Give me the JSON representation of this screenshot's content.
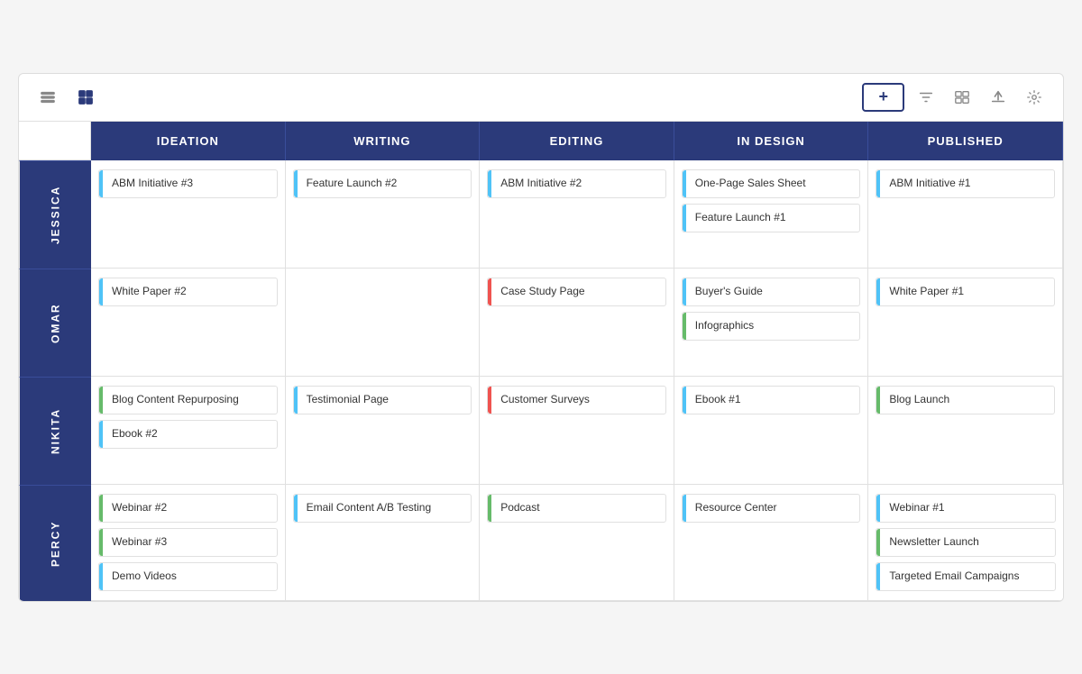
{
  "toolbar": {
    "add_label": "+",
    "views": [
      {
        "id": "list",
        "label": "List view"
      },
      {
        "id": "grid",
        "label": "Grid view"
      }
    ]
  },
  "columns": [
    {
      "id": "ideation",
      "label": "IDEATION"
    },
    {
      "id": "writing",
      "label": "WRITING"
    },
    {
      "id": "editing",
      "label": "EDITING"
    },
    {
      "id": "in_design",
      "label": "IN DESIGN"
    },
    {
      "id": "published",
      "label": "PUBLISHED"
    }
  ],
  "rows": [
    {
      "id": "jessica",
      "label": "JESSICA",
      "cells": {
        "ideation": [
          {
            "text": "ABM Initiative #3",
            "bar": "bar-blue"
          }
        ],
        "writing": [
          {
            "text": "Feature Launch #2",
            "bar": "bar-blue"
          }
        ],
        "editing": [
          {
            "text": "ABM Initiative #2",
            "bar": "bar-blue"
          }
        ],
        "in_design": [
          {
            "text": "One-Page Sales Sheet",
            "bar": "bar-blue"
          },
          {
            "text": "Feature Launch #1",
            "bar": "bar-blue"
          }
        ],
        "published": [
          {
            "text": "ABM Initiative #1",
            "bar": "bar-blue"
          }
        ]
      }
    },
    {
      "id": "omar",
      "label": "OMAR",
      "cells": {
        "ideation": [
          {
            "text": "White Paper #2",
            "bar": "bar-blue"
          }
        ],
        "writing": [],
        "editing": [
          {
            "text": "Case Study Page",
            "bar": "bar-red"
          }
        ],
        "in_design": [
          {
            "text": "Buyer's Guide",
            "bar": "bar-blue"
          },
          {
            "text": "Infographics",
            "bar": "bar-green"
          }
        ],
        "published": [
          {
            "text": "White Paper #1",
            "bar": "bar-blue"
          }
        ]
      }
    },
    {
      "id": "nikita",
      "label": "NIKITA",
      "cells": {
        "ideation": [
          {
            "text": "Blog Content Repurposing",
            "bar": "bar-green"
          },
          {
            "text": "Ebook #2",
            "bar": "bar-blue"
          }
        ],
        "writing": [
          {
            "text": "Testimonial Page",
            "bar": "bar-blue"
          }
        ],
        "editing": [
          {
            "text": "Customer Surveys",
            "bar": "bar-red"
          }
        ],
        "in_design": [
          {
            "text": "Ebook #1",
            "bar": "bar-blue"
          }
        ],
        "published": [
          {
            "text": "Blog Launch",
            "bar": "bar-green"
          }
        ]
      }
    },
    {
      "id": "percy",
      "label": "PERCY",
      "cells": {
        "ideation": [
          {
            "text": "Webinar #2",
            "bar": "bar-green"
          },
          {
            "text": "Webinar #3",
            "bar": "bar-green"
          },
          {
            "text": "Demo Videos",
            "bar": "bar-blue"
          }
        ],
        "writing": [
          {
            "text": "Email Content A/B Testing",
            "bar": "bar-blue"
          }
        ],
        "editing": [
          {
            "text": "Podcast",
            "bar": "bar-green"
          }
        ],
        "in_design": [
          {
            "text": "Resource Center",
            "bar": "bar-blue"
          }
        ],
        "published": [
          {
            "text": "Webinar #1",
            "bar": "bar-blue"
          },
          {
            "text": "Newsletter Launch",
            "bar": "bar-green"
          },
          {
            "text": "Targeted Email Campaigns",
            "bar": "bar-blue"
          }
        ]
      }
    }
  ]
}
